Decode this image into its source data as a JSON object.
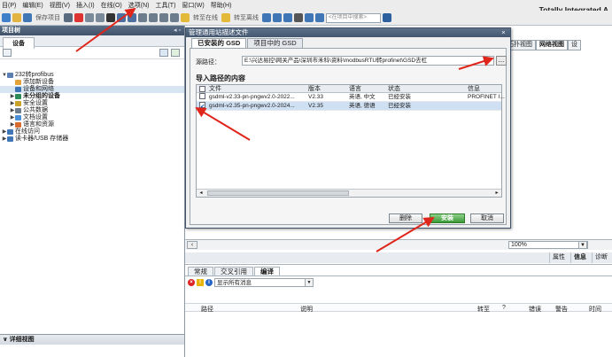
{
  "menu": [
    "目(P)",
    "编辑(E)",
    "视图(V)",
    "插入(I)",
    "在线(O)",
    "选项(N)",
    "工具(T)",
    "窗口(W)",
    "帮助(H)"
  ],
  "brand": "Totally Integrated A",
  "toolbar": {
    "save_project": "保存项目",
    "go_online": "转至在线",
    "go_offline": "转至离线",
    "search_placeholder": "<在项目中搜索>"
  },
  "left_panel": {
    "title": "项目树",
    "tab": "设备",
    "tree": [
      {
        "label": "232转profibus",
        "level": 0,
        "expand": "▼"
      },
      {
        "label": "添加新设备",
        "level": 1,
        "expand": ""
      },
      {
        "label": "设备和网络",
        "level": 1,
        "expand": ""
      },
      {
        "label": "未分组的设备",
        "level": 1,
        "expand": "▶",
        "bold": true
      },
      {
        "label": "安全设置",
        "level": 1,
        "expand": "▶"
      },
      {
        "label": "公共数据",
        "level": 1,
        "expand": "▶"
      },
      {
        "label": "文档设置",
        "level": 1,
        "expand": "▶"
      },
      {
        "label": "语言和资源",
        "level": 1,
        "expand": "▶"
      },
      {
        "label": "在线访问",
        "level": 0,
        "expand": "▶"
      },
      {
        "label": "读卡器/USB 存储器",
        "level": 0,
        "expand": "▶"
      }
    ],
    "detail_view": "详细视图"
  },
  "editor": {
    "view_tabs": [
      "拓扑视图",
      "网络视图",
      "设"
    ],
    "zoom": "100%"
  },
  "info_tabs": [
    "属性",
    "信息",
    "诊断"
  ],
  "bottom": {
    "tabs": [
      "常规",
      "交叉引用",
      "编译"
    ],
    "filter": "显示所有消息",
    "columns": [
      "路径",
      "说明",
      "转至",
      "?",
      "错误",
      "警告",
      "时间"
    ]
  },
  "dialog": {
    "title": "管理通用站描述文件",
    "tabs": [
      "已安装的 GSD",
      "项目中的 GSD"
    ],
    "source_label": "源路径：",
    "source_path": "E:\\兴达易控\\网关产品\\深圳市禾科\\资料\\modbusRTU转profinet\\GSD去杠",
    "browse": "...",
    "import_title": "导入路径的内容",
    "table": {
      "columns": [
        "文件",
        "版本",
        "语言",
        "状态",
        "信息"
      ],
      "rows": [
        {
          "file": "gsdml-v2.33-pn-pngwv2.0-2022...",
          "version": "V2.33",
          "language": "英语, 中文",
          "status": "已经安装",
          "info": "PROFINET I...",
          "checked": false
        },
        {
          "file": "gsdml-v2.35-pn-pngwv2.0-2024...",
          "version": "V2.35",
          "language": "英语, 德语",
          "status": "已经安装",
          "info": "",
          "checked": true
        }
      ]
    },
    "buttons": {
      "delete": "删除",
      "install": "安装",
      "cancel": "取消"
    }
  }
}
